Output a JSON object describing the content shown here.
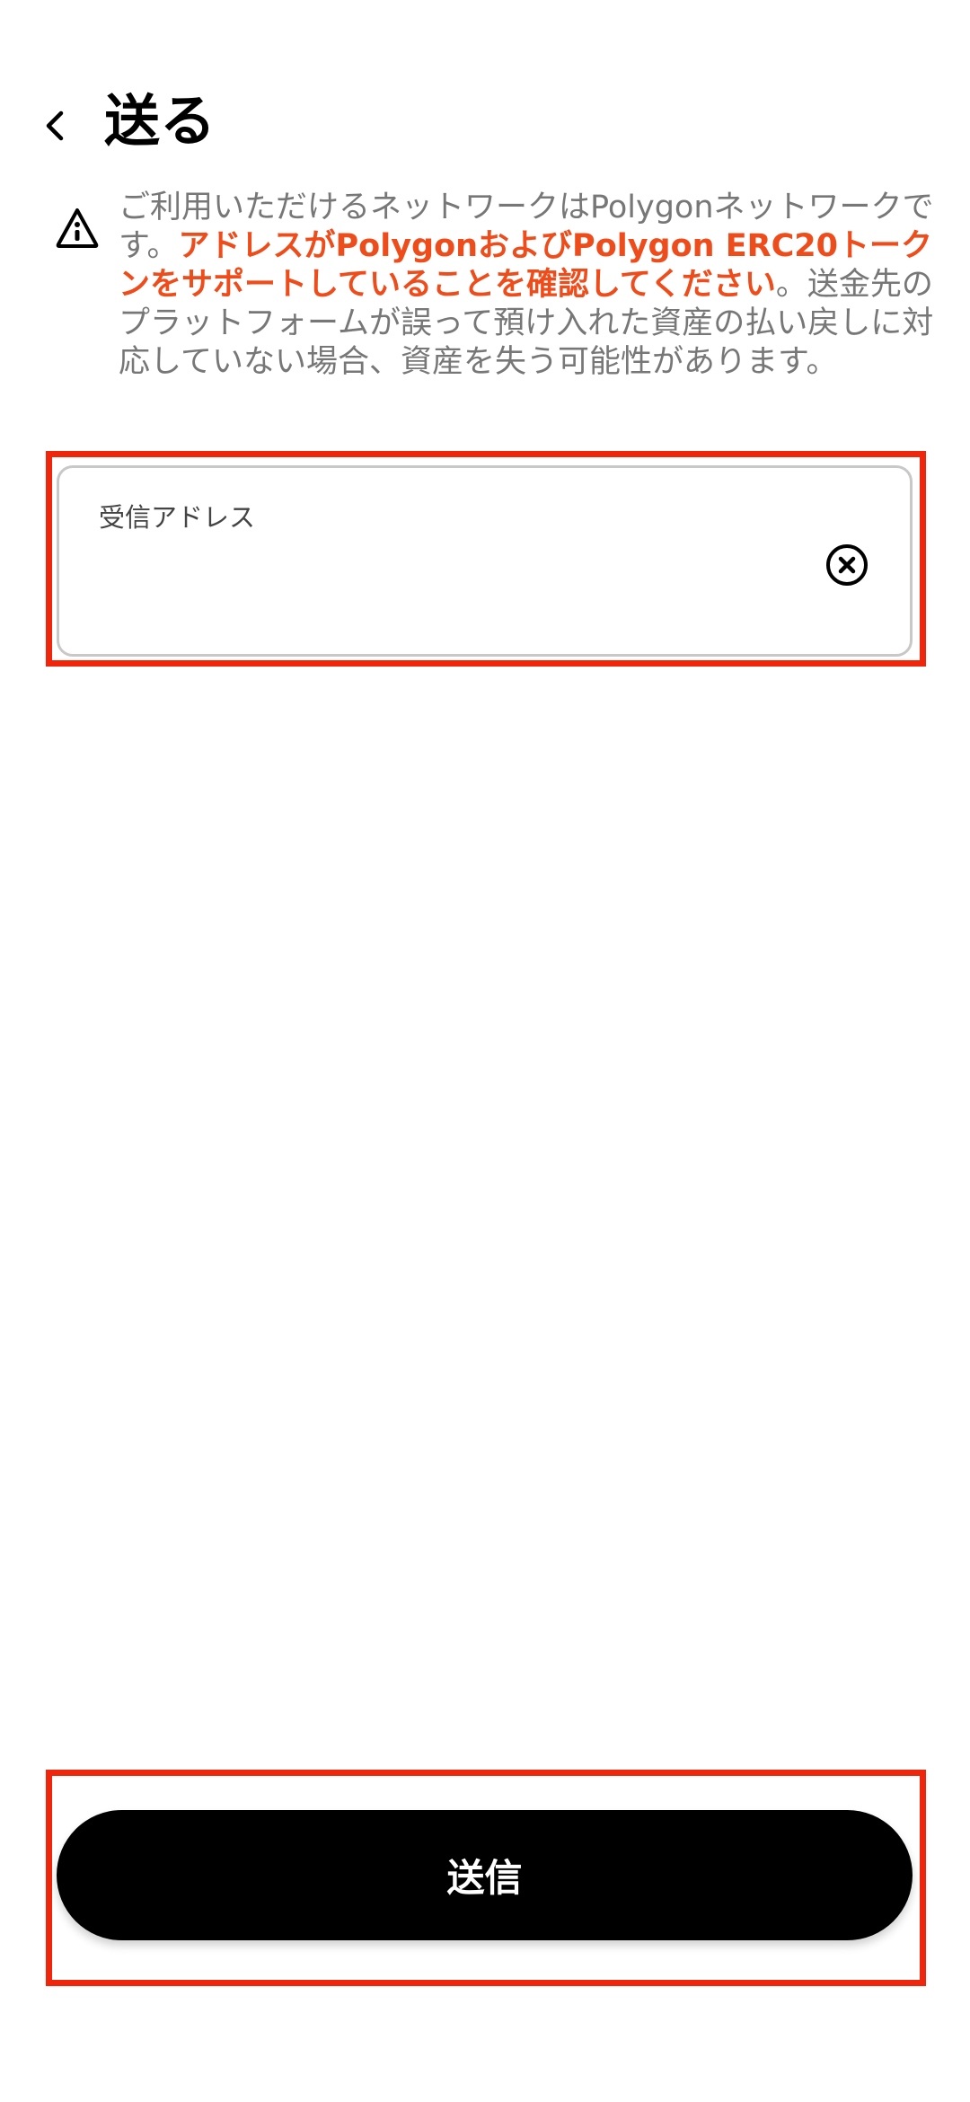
{
  "header": {
    "title": "送る",
    "back_icon": "chevron-left-icon"
  },
  "notice": {
    "icon": "info-triangle-icon",
    "text_part1": "ご利用いただけるネットワークはPolygonネットワークです。",
    "text_warning": "アドレスがPolygonおよびPolygon ERC20トークンをサポートしていることを確認してください",
    "text_part2": "。送金先のプラットフォームが誤って預け入れた資産の払い戻しに対応していない場合、資産を失う可能性があります。",
    "warning_color": "#ee4d1b"
  },
  "address_field": {
    "label": "受信アドレス",
    "value": "",
    "clear_icon": "clear-circle-x-icon"
  },
  "send_button": {
    "label": "送信"
  },
  "colors": {
    "highlight": "#f0260c",
    "button_bg": "#000000",
    "notice_text": "#777777"
  }
}
